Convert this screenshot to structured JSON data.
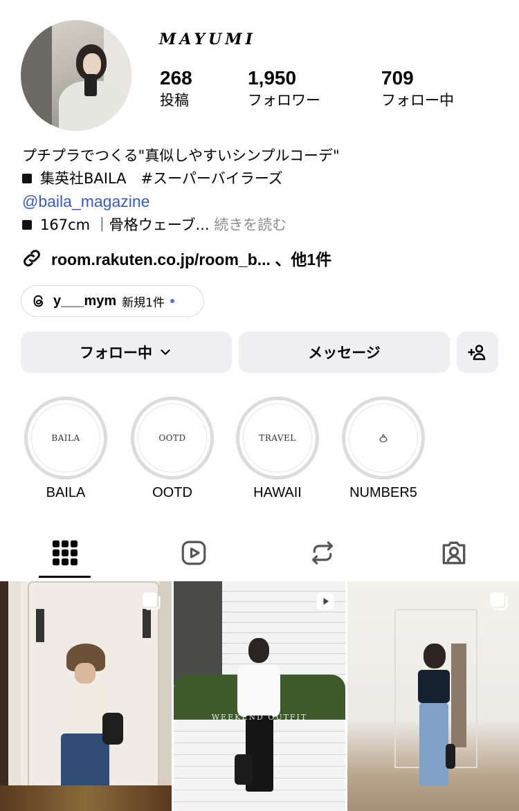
{
  "profile": {
    "username": "MAYUMI",
    "avatar": "profile-photo"
  },
  "stats": [
    {
      "value": "268",
      "label": "投稿"
    },
    {
      "value": "1,950",
      "label": "フォロワー"
    },
    {
      "value": "709",
      "label": "フォロー中"
    }
  ],
  "bio": {
    "line1": "プチプラでつくる\"真似しやすいシンプルコーデ\"",
    "line2": "集英社BAILA　#スーパーバイラーズ",
    "mention": "@baila_magazine",
    "line4": "167cm ｜骨格ウェーブ... ",
    "more": "続きを読む",
    "square_icon": "black-square-emoji"
  },
  "link": {
    "text": "room.rakuten.co.jp/room_b... 、他1件",
    "icon": "link-icon"
  },
  "threads": {
    "handle": "y___mym",
    "badge": "新規1件",
    "icon": "threads-icon",
    "dot_color": "#5b6ed8"
  },
  "buttons": {
    "follow": "フォロー中",
    "message": "メッセージ",
    "add_icon": "add-person-icon"
  },
  "highlights": [
    {
      "cover": "BAILA",
      "label": "BAILA"
    },
    {
      "cover": "OOTD",
      "label": "OOTD"
    },
    {
      "cover": "TRAVEL",
      "label": "HAWAII"
    },
    {
      "cover": "",
      "label": "NUMBER5"
    }
  ],
  "tabs": [
    {
      "name": "posts-grid-icon",
      "active": true
    },
    {
      "name": "reels-icon",
      "active": false
    },
    {
      "name": "reposts-icon",
      "active": false
    },
    {
      "name": "tagged-icon",
      "active": false
    }
  ],
  "posts": [
    {
      "type": "carousel",
      "badge": "multi-photo-icon"
    },
    {
      "type": "reel",
      "badge": "reel-icon",
      "overlay_text": "WEEKEND OUTFIT"
    },
    {
      "type": "carousel",
      "badge": "multi-photo-icon"
    }
  ],
  "colors": {
    "mention": "#3b58c6",
    "button_bg": "#efeff1",
    "highlight_ring": "#dcdcde"
  }
}
